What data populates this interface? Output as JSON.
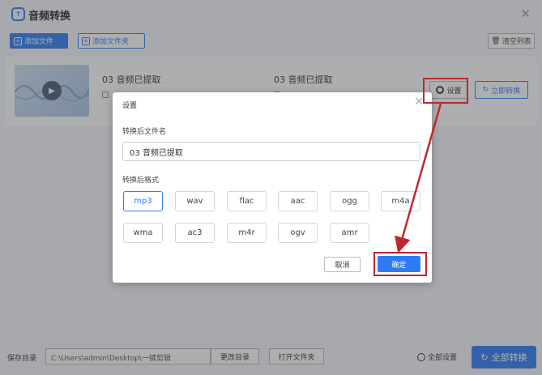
{
  "app": {
    "title": "音频转换",
    "logo_text": "↑",
    "close_glyph": "✕",
    "add_file_label": "添加文件",
    "add_folder_label": "添加文件夹",
    "clear_list_label": "清空列表"
  },
  "file_row": {
    "source_name": "03 音频已提取",
    "target_name": "03 音频已提取",
    "settings_label": "设置",
    "convert_now_label": "立即转换"
  },
  "bottom": {
    "save_dir_label": "保存目录",
    "save_path": "C:\\Users\\admin\\Desktop\\一键剪辑",
    "change_dir_label": "更改目录",
    "open_folder_label": "打开文件夹",
    "all_settings_label": "全部设置",
    "convert_all_label": "全部转换"
  },
  "dialog": {
    "title": "设置",
    "close_glyph": "✕",
    "name_label": "转换后文件名",
    "name_value": "03 音频已提取",
    "format_label": "转换后格式",
    "formats": [
      "mp3",
      "wav",
      "flac",
      "aac",
      "ogg",
      "m4a",
      "wma",
      "ac3",
      "m4r",
      "ogv",
      "amr"
    ],
    "selected_format": "mp3",
    "cancel_label": "取消",
    "ok_label": "确定"
  },
  "colors": {
    "accent": "#2d7cf6",
    "annotation": "#c0262d"
  }
}
